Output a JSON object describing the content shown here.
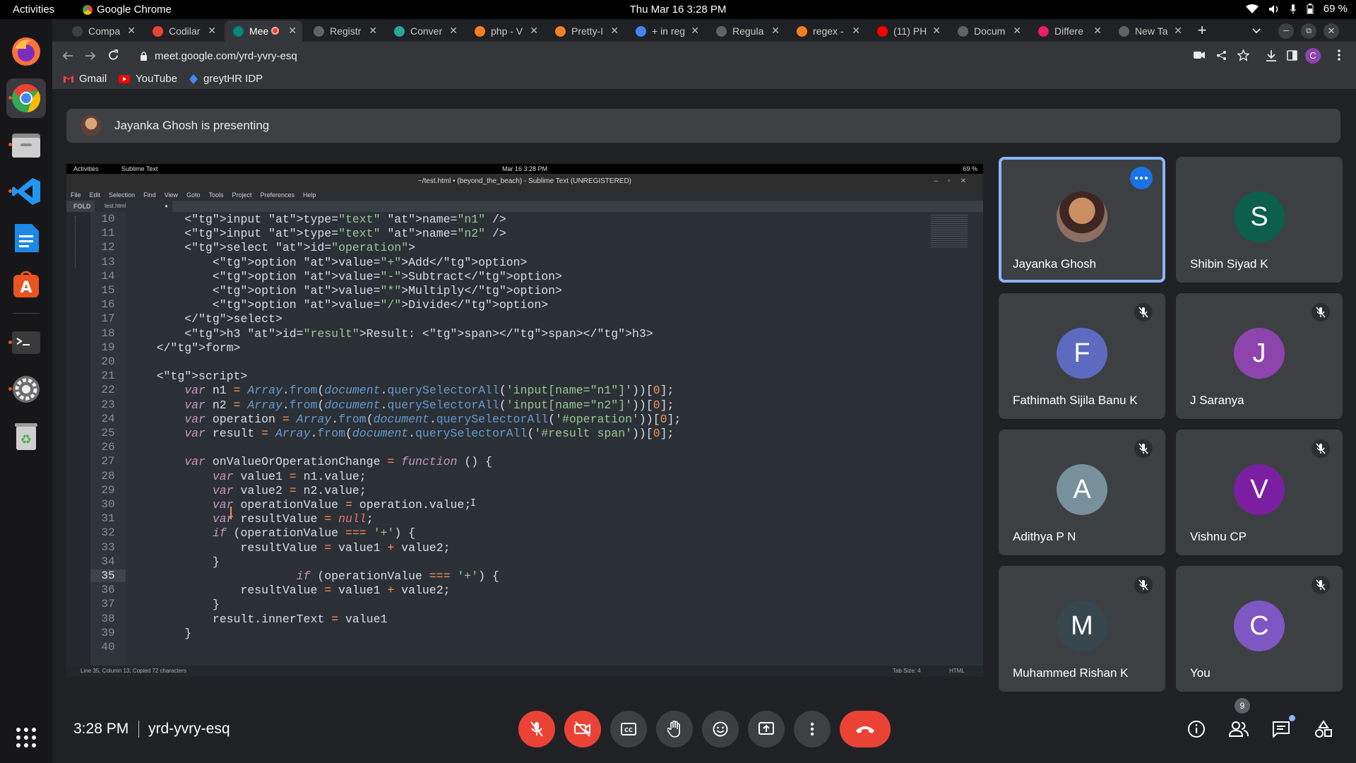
{
  "os": {
    "activities": "Activities",
    "app_name": "Google Chrome",
    "datetime": "Thu Mar 16  3:28 PM",
    "battery": "69 %"
  },
  "tabs": [
    {
      "label": "Compa",
      "color": "#3c4043"
    },
    {
      "label": "Codilar",
      "color": "#ea4335"
    },
    {
      "label": "Mee",
      "color": "#00897b"
    },
    {
      "label": "Registr",
      "color": "#5f6368"
    },
    {
      "label": "Conver",
      "color": "#26a69a"
    },
    {
      "label": "php - V",
      "color": "#f48024"
    },
    {
      "label": "Pretty-I",
      "color": "#f48024"
    },
    {
      "label": "+ in reg",
      "color": "#4285f4"
    },
    {
      "label": "Regula",
      "color": "#5f6368"
    },
    {
      "label": "regex -",
      "color": "#f48024"
    },
    {
      "label": "(11) PH",
      "color": "#ff0000"
    },
    {
      "label": "Docum",
      "color": "#5f6368"
    },
    {
      "label": "Differe",
      "color": "#e91e63"
    },
    {
      "label": "New Ta",
      "color": "#5f6368"
    }
  ],
  "omnibox": {
    "url": "meet.google.com/yrd-yvry-esq"
  },
  "bookmarks": [
    {
      "label": "Gmail"
    },
    {
      "label": "YouTube"
    },
    {
      "label": "greytHR IDP"
    }
  ],
  "meet": {
    "presenting_text": "Jayanka Ghosh is presenting",
    "time": "3:28 PM",
    "meeting_code": "yrd-yvry-esq",
    "participants_badge": "9"
  },
  "shared_screen": {
    "os_activities": "Activities",
    "os_app": "Sublime Text",
    "os_datetime": "Mar 16  3:28 PM",
    "os_battery": "69 %",
    "window_title": "~/test.html • (beyond_the_beach) - Sublime Text (UNREGISTERED)",
    "menu": [
      "File",
      "Edit",
      "Selection",
      "Find",
      "View",
      "Goto",
      "Tools",
      "Project",
      "Preferences",
      "Help"
    ],
    "tab_name": "test.html",
    "folders_label": "FOLD",
    "status_left": "Line 35, Column 13; Copied 72 characters",
    "status_tab": "Tab Size: 4",
    "status_syntax": "HTML",
    "line_numbers": [
      "10",
      "11",
      "12",
      "13",
      "14",
      "15",
      "16",
      "17",
      "18",
      "19",
      "20",
      "21",
      "22",
      "23",
      "24",
      "25",
      "26",
      "27",
      "28",
      "29",
      "30",
      "31",
      "32",
      "33",
      "34",
      "35",
      "36",
      "37",
      "38",
      "39",
      "40"
    ],
    "current_line": "35",
    "code_lines": [
      "        <input type=\"text\" name=\"n1\" />",
      "        <input type=\"text\" name=\"n2\" />",
      "        <select id=\"operation\">",
      "            <option value=\"+\">Add</option>",
      "            <option value=\"-\">Subtract</option>",
      "            <option value=\"*\">Multiply</option>",
      "            <option value=\"/\">Divide</option>",
      "        </select>",
      "        <h3 id=\"result\">Result: <span></span></h3>",
      "    </form>",
      "",
      "    <script>",
      "        var n1 = Array.from(document.querySelectorAll('input[name=\"n1\"]'))[0];",
      "        var n2 = Array.from(document.querySelectorAll('input[name=\"n2\"]'))[0];",
      "        var operation = Array.from(document.querySelectorAll('#operation'))[0];",
      "        var result = Array.from(document.querySelectorAll('#result span'))[0];",
      "",
      "        var onValueOrOperationChange = function () {",
      "            var value1 = n1.value;",
      "            var value2 = n2.value;",
      "            var operationValue = operation.value;",
      "            var resultValue = null;",
      "            if (operationValue === '+') {",
      "                resultValue = value1 + value2;",
      "            }",
      "                        if (operationValue === '+') {",
      "                resultValue = value1 + value2;",
      "            }",
      "            result.innerText = value1",
      "        }",
      ""
    ]
  },
  "participants": [
    {
      "name": "Jayanka Ghosh",
      "initial": "",
      "color": "#8d6e63",
      "muted": false,
      "presenting": true
    },
    {
      "name": "Shibin Siyad K",
      "initial": "S",
      "color": "#0b5f4b",
      "muted": false,
      "presenting": false
    },
    {
      "name": "Fathimath Sijila Banu K",
      "initial": "F",
      "color": "#5c6bc0",
      "muted": true,
      "presenting": false
    },
    {
      "name": "J Saranya",
      "initial": "J",
      "color": "#8e44ad",
      "muted": true,
      "presenting": false
    },
    {
      "name": "Adithya P N",
      "initial": "A",
      "color": "#78909c",
      "muted": true,
      "presenting": false
    },
    {
      "name": "Vishnu CP",
      "initial": "V",
      "color": "#7b1fa2",
      "muted": true,
      "presenting": false
    },
    {
      "name": "Muhammed Rishan K",
      "initial": "M",
      "color": "#37474f",
      "muted": true,
      "presenting": false
    },
    {
      "name": "You",
      "initial": "C",
      "color": "#7e57c2",
      "muted": true,
      "presenting": false
    }
  ],
  "controls": [
    "mic-off-icon",
    "camera-off-icon",
    "captions-icon",
    "raise-hand-icon",
    "emoji-icon",
    "present-icon",
    "more-vert-icon",
    "end-call-icon"
  ],
  "colors": {
    "accent": "#8ab4f8",
    "danger": "#ea4335",
    "background": "#202124",
    "tile": "#3c4043"
  }
}
